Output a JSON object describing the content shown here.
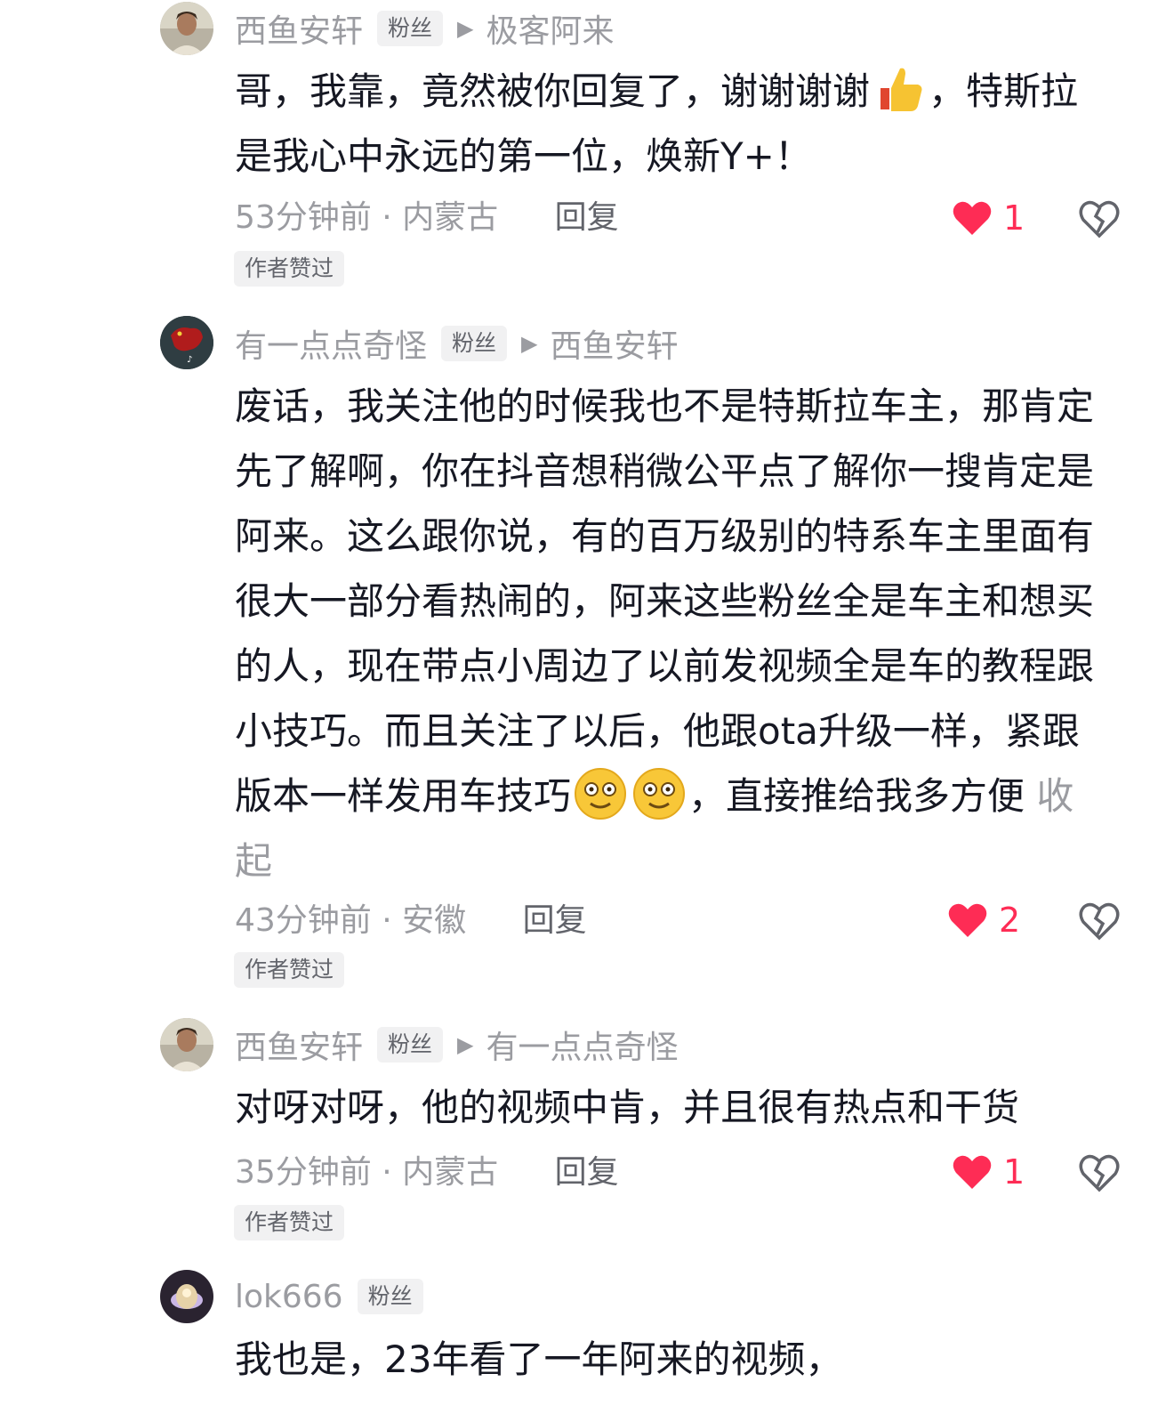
{
  "comments": [
    {
      "username": "西鱼安轩",
      "badge": "粉丝",
      "reply_to": "极客阿来",
      "text": "哥，我靠，竟然被你回复了，谢谢谢谢",
      "emoji_1": "thumbs-up-emoji",
      "text_after": "，特斯拉是我心中永远的第一位，焕新Y+！",
      "time_location": "53分钟前 · 内蒙古",
      "reply_label": "回复",
      "likes": "1",
      "author_tag": "作者赞过"
    },
    {
      "username": "有一点点奇怪",
      "badge": "粉丝",
      "reply_to": "西鱼安轩",
      "text": "废话，我关注他的时候我也不是特斯拉车主，那肯定先了解啊，你在抖音想稍微公平点了解你一搜肯定是阿来。这么跟你说，有的百万级别的特系车主里面有很大一部分看热闹的，阿来这些粉丝全是车主和想买的人，现在带点小周边了以前发视频全是车的教程跟小技巧。而且关注了以后，他跟ota升级一样，紧跟版本一样发用车技巧",
      "text_after": "，直接推给我多方便",
      "collapse_label": "收起",
      "time_location": "43分钟前 · 安徽",
      "reply_label": "回复",
      "likes": "2",
      "author_tag": "作者赞过"
    },
    {
      "username": "西鱼安轩",
      "badge": "粉丝",
      "reply_to": "有一点点奇怪",
      "text": "对呀对呀，他的视频中肯，并且很有热点和干货",
      "time_location": "35分钟前 · 内蒙古",
      "reply_label": "回复",
      "likes": "1",
      "author_tag": "作者赞过"
    },
    {
      "username": "lok666",
      "badge": "粉丝",
      "text": "我也是，23年看了一年阿来的视频，"
    }
  ],
  "colors": {
    "like": "#fe2c55",
    "muted": "#9b9ca1",
    "text": "#161823",
    "tag_bg": "#f1f1f2"
  }
}
